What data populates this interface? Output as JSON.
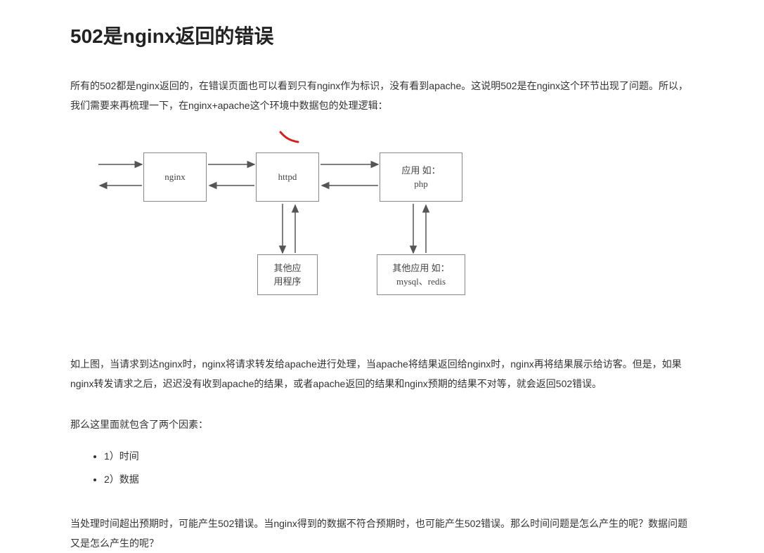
{
  "heading": "502是nginx返回的错误",
  "para1": "所有的502都是nginx返回的，在错误页面也可以看到只有nginx作为标识，没有看到apache。这说明502是在nginx这个环节出现了问题。所以，我们需要来再梳理一下，在nginx+apache这个环境中数据包的处理逻辑：",
  "diagram": {
    "box_nginx": "nginx",
    "box_httpd": "httpd",
    "box_app": "应用 如：\nphp",
    "box_other1": "其他应\n用程序",
    "box_other2": "其他应用 如：\nmysql、redis"
  },
  "para2": "如上图，当请求到达nginx时，nginx将请求转发给apache进行处理，当apache将结果返回给nginx时，nginx再将结果展示给访客。但是，如果nginx转发请求之后，迟迟没有收到apache的结果，或者apache返回的结果和nginx预期的结果不对等，就会返回502错误。",
  "para3": "那么这里面就包含了两个因素：",
  "factors": {
    "f1": "1）时间",
    "f2": "2）数据"
  },
  "para4": "当处理时间超出预期时，可能产生502错误。当nginx得到的数据不符合预期时，也可能产生502错误。那么时间问题是怎么产生的呢？数据问题又是怎么产生的呢？"
}
